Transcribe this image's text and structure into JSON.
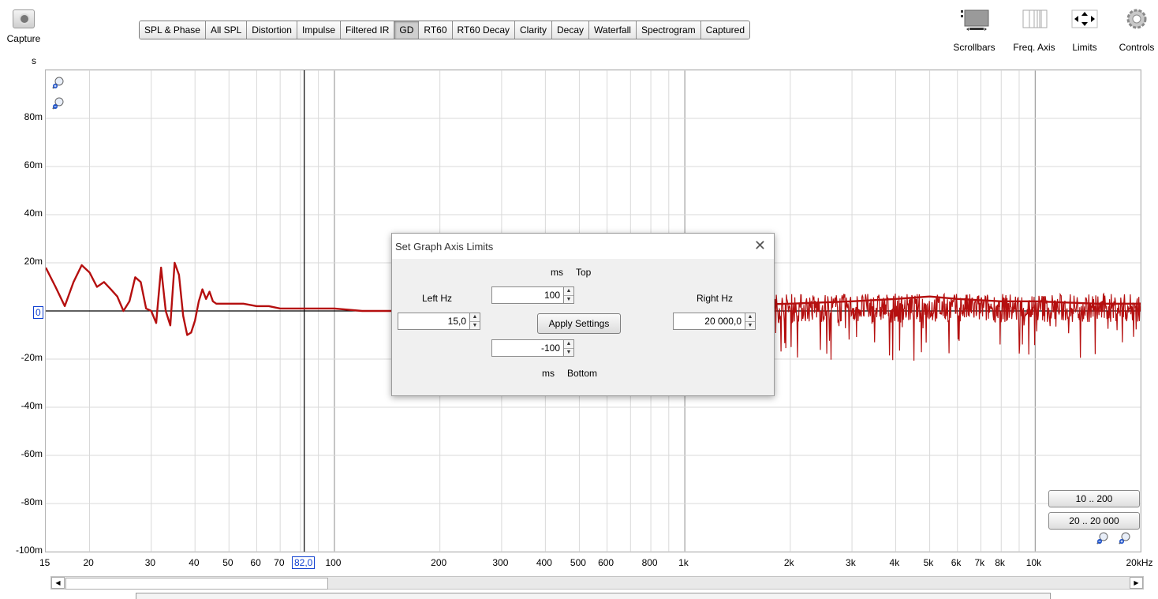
{
  "toolbar": {
    "capture_label": "Capture",
    "tabs": [
      "SPL & Phase",
      "All SPL",
      "Distortion",
      "Impulse",
      "Filtered IR",
      "GD",
      "RT60",
      "RT60 Decay",
      "Clarity",
      "Decay",
      "Waterfall",
      "Spectrogram",
      "Captured"
    ],
    "active_tab": "GD",
    "tools": {
      "scrollbars": "Scrollbars",
      "freq_axis": "Freq. Axis",
      "limits": "Limits",
      "controls": "Controls"
    }
  },
  "graph": {
    "unit": "s",
    "y_ticks": [
      "80m",
      "60m",
      "40m",
      "20m",
      "-20m",
      "-40m",
      "-60m",
      "-80m",
      "-100m"
    ],
    "x_ticks": [
      "15",
      "20",
      "30",
      "40",
      "50",
      "60",
      "70",
      "100",
      "200",
      "300",
      "400",
      "500",
      "600",
      "800",
      "1k",
      "2k",
      "3k",
      "4k",
      "5k",
      "6k",
      "7k",
      "8k",
      "10k",
      "20kHz"
    ],
    "cursor_x": "82,0",
    "cursor_y": "0",
    "presets": [
      "10 .. 200",
      "20 .. 20 000"
    ],
    "line_color": "#b50f0f"
  },
  "chart_data": {
    "type": "line",
    "xlabel": "",
    "ylabel": "s",
    "xscale": "log",
    "xlim": [
      15,
      20000
    ],
    "ylim": [
      -0.1,
      0.1
    ],
    "grid": true,
    "series": [
      {
        "color": "#b50f0f",
        "x": [
          15,
          16,
          17,
          18,
          19,
          20,
          21,
          22,
          23,
          24,
          25,
          26,
          27,
          28,
          29,
          30,
          31,
          32,
          33,
          34,
          35,
          36,
          37,
          38,
          39,
          40,
          41,
          42,
          43,
          44,
          45,
          46,
          48,
          50,
          55,
          60,
          65,
          70,
          80,
          90,
          100,
          120,
          150,
          200,
          300,
          500,
          800,
          1000,
          2000,
          3000,
          4000,
          5000,
          6000,
          8000,
          10000,
          15000,
          20000
        ],
        "y": [
          0.018,
          0.01,
          0.002,
          0.012,
          0.019,
          0.016,
          0.01,
          0.012,
          0.009,
          0.006,
          0.0,
          0.004,
          0.014,
          0.012,
          0.001,
          0.0,
          -0.005,
          0.018,
          0.0,
          -0.006,
          0.02,
          0.015,
          -0.002,
          -0.01,
          -0.009,
          -0.004,
          0.004,
          0.009,
          0.005,
          0.008,
          0.004,
          0.003,
          0.003,
          0.003,
          0.003,
          0.002,
          0.002,
          0.001,
          0.001,
          0.001,
          0.001,
          0.0,
          0.0,
          0.0,
          0.0,
          0.0,
          0.001,
          0.002,
          0.003,
          0.004,
          0.005,
          0.006,
          0.005,
          0.004,
          0.004,
          0.003,
          0.003
        ]
      }
    ]
  },
  "dialog": {
    "title": "Set Graph Axis Limits",
    "close": "✕",
    "top_unit": "ms",
    "top_label": "Top",
    "top_value": "100",
    "left_label": "Left Hz",
    "left_value": "15,0",
    "right_label": "Right Hz",
    "right_value": "20 000,0",
    "apply": "Apply Settings",
    "bottom_value": "-100",
    "bottom_unit": "ms",
    "bottom_label": "Bottom"
  }
}
